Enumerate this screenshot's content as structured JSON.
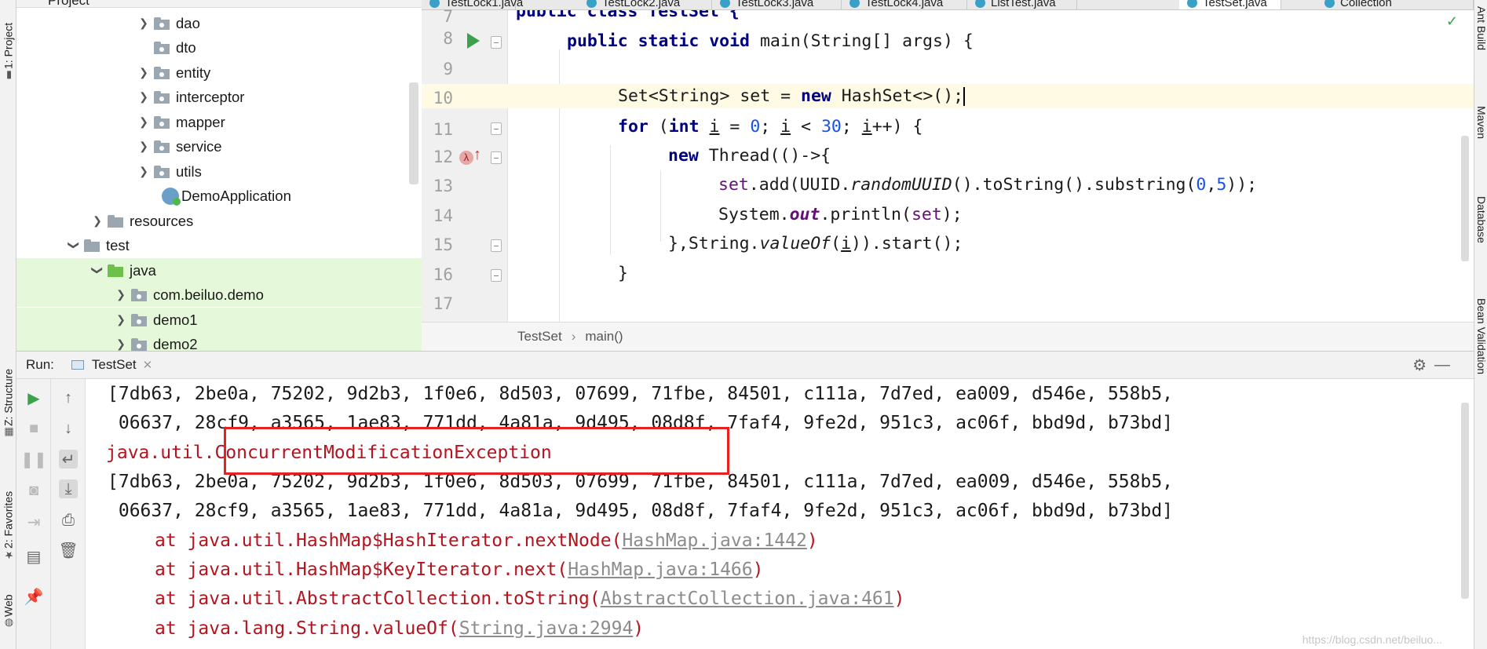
{
  "left_strip": {
    "tabs": [
      {
        "label": "1: Project",
        "icon": "folder-icon"
      },
      {
        "label": "Z: Structure",
        "icon": "structure-icon"
      },
      {
        "label": "2: Favorites",
        "icon": "star-icon"
      },
      {
        "label": "Web",
        "icon": "globe-icon"
      }
    ]
  },
  "right_strip": {
    "tabs": [
      {
        "label": "Ant Build"
      },
      {
        "label": "Maven"
      },
      {
        "label": "Database"
      },
      {
        "label": "Bean Validation"
      }
    ]
  },
  "project": {
    "header_label": "Project",
    "items": [
      {
        "label": "dao",
        "kind": "package",
        "expandable": true
      },
      {
        "label": "dto",
        "kind": "package",
        "expandable": false
      },
      {
        "label": "entity",
        "kind": "package",
        "expandable": true
      },
      {
        "label": "interceptor",
        "kind": "package",
        "expandable": true
      },
      {
        "label": "mapper",
        "kind": "package",
        "expandable": true
      },
      {
        "label": "service",
        "kind": "package",
        "expandable": true
      },
      {
        "label": "utils",
        "kind": "package",
        "expandable": true
      },
      {
        "label": "DemoApplication",
        "kind": "app",
        "expandable": false
      },
      {
        "label": "resources",
        "kind": "resources",
        "expandable": true
      },
      {
        "label": "test",
        "kind": "folder",
        "expandable": true,
        "expanded": true
      },
      {
        "label": "java",
        "kind": "source",
        "expandable": true,
        "expanded": true
      },
      {
        "label": "com.beiluo.demo",
        "kind": "package",
        "expandable": true
      },
      {
        "label": "demo1",
        "kind": "package",
        "expandable": true
      },
      {
        "label": "demo2",
        "kind": "package",
        "expandable": true
      }
    ]
  },
  "editor": {
    "tabs": [
      {
        "label": "TestLock1.java"
      },
      {
        "label": "TestLock2.java"
      },
      {
        "label": "TestLock3.java"
      },
      {
        "label": "TestLock4.java"
      },
      {
        "label": "ListTest.java"
      },
      {
        "label": "TestSet.java",
        "active": true
      },
      {
        "label": "Collection"
      }
    ],
    "line_numbers": [
      "7",
      "8",
      "9",
      "10",
      "11",
      "12",
      "13",
      "14",
      "15",
      "16",
      "17"
    ],
    "code": {
      "l7": "public class TestSet {",
      "l8_a": "public static void ",
      "l8_b": "main(String[] args) {",
      "l10_a": "Set<String> set = ",
      "l10_b": "new",
      "l10_c": " HashSet<>();",
      "l11_a": "for",
      "l11_b": " (",
      "l11_c": "int",
      "l11_d": " ",
      "l11_e": "i",
      "l11_f": " = ",
      "l11_g": "0",
      "l11_h": "; ",
      "l11_i": "i",
      "l11_j": " < ",
      "l11_k": "30",
      "l11_l": "; ",
      "l11_m": "i",
      "l11_n": "++) {",
      "l12_a": "new",
      "l12_b": " Thread(()->{",
      "l13_a": "set",
      "l13_b": ".add(UUID.",
      "l13_c": "randomUUID",
      "l13_d": "().toString().substring(",
      "l13_e": "0",
      "l13_f": ",",
      "l13_g": "5",
      "l13_h": "));",
      "l14_a": "System.",
      "l14_b": "out",
      "l14_c": ".println(",
      "l14_d": "set",
      "l14_e": ");",
      "l15_a": "},String.",
      "l15_b": "valueOf",
      "l15_c": "(",
      "l15_d": "i",
      "l15_e": ")).start();",
      "l16": "}"
    },
    "lambda_marker": "λ"
  },
  "breadcrumb": {
    "class": "TestSet",
    "method": "main()"
  },
  "run": {
    "label": "Run:",
    "tab_label": "TestSet",
    "console": {
      "line1": "[7db63, 2be0a, 75202, 9d2b3, 1f0e6, 8d503, 07699, 71fbe, 84501, c111a, 7d7ed, ea009, d546e, 558b5,",
      "line2": " 06637, 28cf9, a3565, 1ae83, 771dd, 4a81a, 9d495, 08d8f, 7faf4, 9fe2d, 951c3, ac06f, bbd9d, b73bd]",
      "line3_a": "java.util.",
      "line3_b": "ConcurrentModificationException",
      "line4": "[7db63, 2be0a, 75202, 9d2b3, 1f0e6, 8d503, 07699, 71fbe, 84501, c111a, 7d7ed, ea009, d546e, 558b5,",
      "line5": " 06637, 28cf9, a3565, 1ae83, 771dd, 4a81a, 9d495, 08d8f, 7faf4, 9fe2d, 951c3, ac06f, bbd9d, b73bd]",
      "stack": [
        {
          "prefix": "at java.util.HashMap$HashIterator.nextNode(",
          "link": "HashMap.java:1442",
          "suffix": ")"
        },
        {
          "prefix": "at java.util.HashMap$KeyIterator.next(",
          "link": "HashMap.java:1466",
          "suffix": ")"
        },
        {
          "prefix": "at java.util.AbstractCollection.toString(",
          "link": "AbstractCollection.java:461",
          "suffix": ")"
        },
        {
          "prefix": "at java.lang.String.valueOf(",
          "link": "String.java:2994",
          "suffix": ")"
        }
      ]
    },
    "watermark": "https://blog.csdn.net/beiluo..."
  },
  "colors": {
    "error_red": "#b4141e",
    "highlight_box": "#e82020",
    "keyword": "#000080",
    "number": "#1750eb",
    "field": "#660e7a",
    "run_green": "#3aa24a"
  }
}
